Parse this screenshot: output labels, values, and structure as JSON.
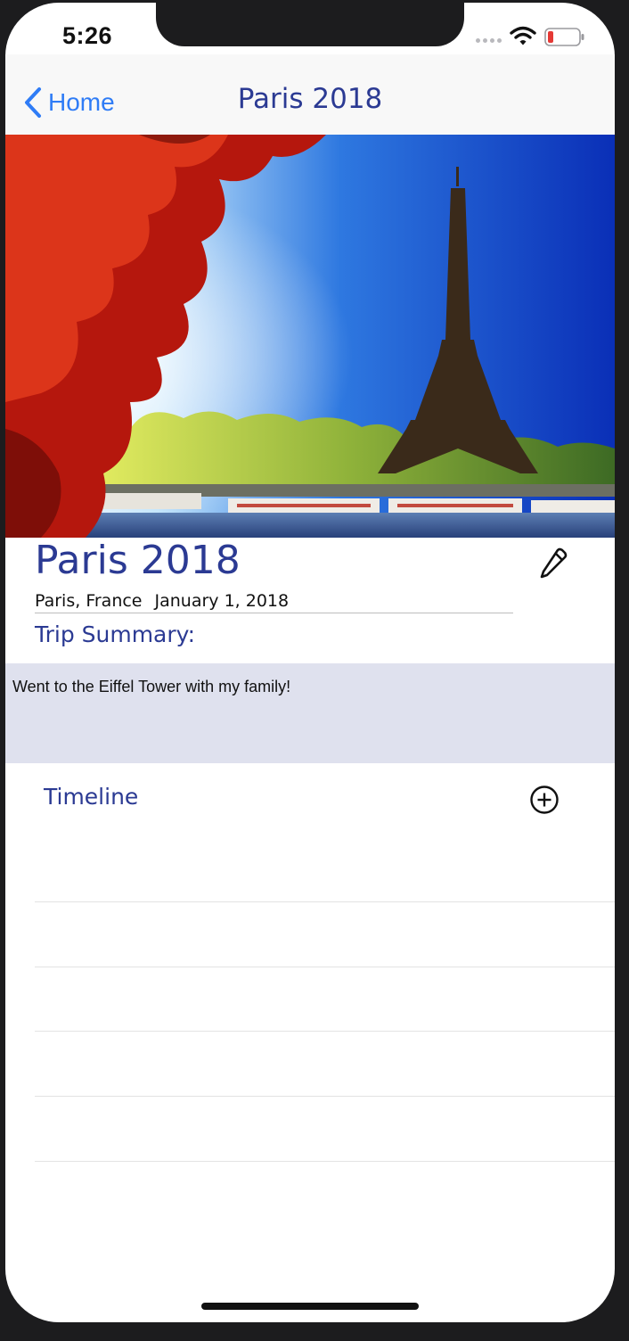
{
  "status_bar": {
    "time": "5:26"
  },
  "nav": {
    "back_label": "Home",
    "title": "Paris 2018"
  },
  "trip": {
    "title": "Paris 2018",
    "location": "Paris, France",
    "date": "January 1, 2018",
    "summary_label": "Trip Summary:",
    "summary_text": "Went to the Eiffel Tower with my family!"
  },
  "timeline": {
    "label": "Timeline",
    "entries": [
      "",
      "",
      "",
      "",
      ""
    ]
  },
  "icons": {
    "back": "chevron-left-icon",
    "edit": "pencil-icon",
    "add": "plus-circle-icon",
    "wifi": "wifi-icon",
    "battery": "battery-low-icon"
  },
  "colors": {
    "accent_blue": "#2f7cf6",
    "title_navy": "#2b3a93",
    "summary_bg": "#dfe1ee",
    "battery_low": "#e53935"
  }
}
